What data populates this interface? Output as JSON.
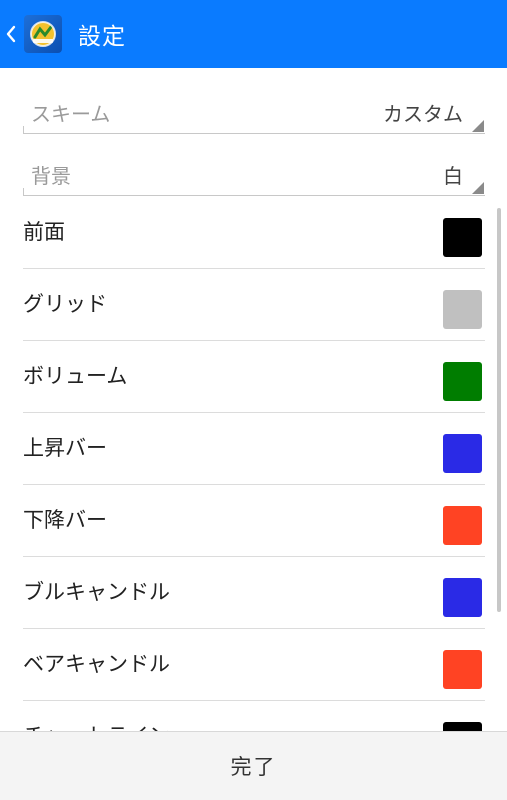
{
  "header": {
    "title": "設定",
    "back_icon": "chevron-left-icon",
    "app_icon": "metatrader-logo-icon",
    "background_color": "#0a7bff"
  },
  "settings": {
    "scheme": {
      "label": "スキーム",
      "value": "カスタム"
    },
    "background": {
      "label": "背景",
      "value": "白"
    }
  },
  "colors": [
    {
      "label": "前面",
      "color": "#000000"
    },
    {
      "label": "グリッド",
      "color": "#c0c0c0"
    },
    {
      "label": "ボリューム",
      "color": "#007d00"
    },
    {
      "label": "上昇バー",
      "color": "#2a2ae6"
    },
    {
      "label": "下降バー",
      "color": "#ff4323"
    },
    {
      "label": "ブルキャンドル",
      "color": "#2a2ae6"
    },
    {
      "label": "ベアキャンドル",
      "color": "#ff4323"
    },
    {
      "label": "チャートライン",
      "color": "#000000"
    }
  ],
  "footer": {
    "done_label": "完了"
  }
}
